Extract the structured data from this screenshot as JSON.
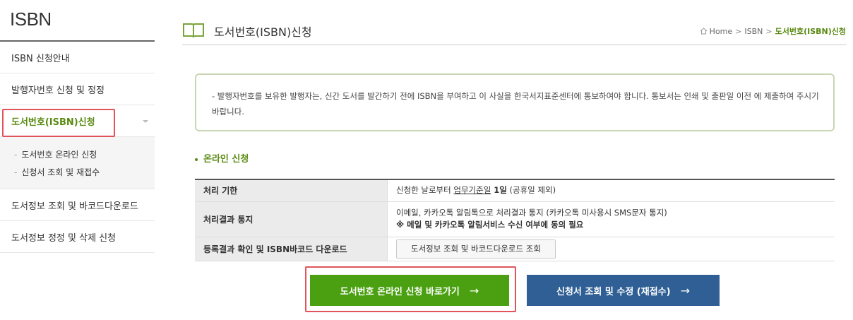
{
  "sidebar": {
    "title": "ISBN",
    "items": [
      {
        "label": "ISBN 신청안내"
      },
      {
        "label": "발행자번호 신청 및 정정"
      },
      {
        "label": "도서번호(ISBN)신청"
      },
      {
        "label": "도서정보 조회 및 바코드다운로드"
      },
      {
        "label": "도서정보 정정 및 삭제 신청"
      }
    ],
    "sub_items": [
      {
        "label": "도서번호 온라인 신청"
      },
      {
        "label": "신청서 조회 및 재접수"
      }
    ],
    "sub_dash": "-"
  },
  "header": {
    "title": "도서번호(ISBN)신청",
    "breadcrumb": [
      "Home",
      "ISBN",
      "도서번호(ISBN)신청"
    ],
    "breadcrumb_sep": ">"
  },
  "notice": {
    "text": "- 발행자번호를 보유한 발행자는, 신간 도서를 발간하기 전에 ISBN을 부여하고 이 사실을 한국서지표준센터에 통보하여야 합니다. 통보서는 인쇄 및 출판일 이전 에 제출하여 주시기 바랍니다."
  },
  "section": {
    "title": "온라인 신청"
  },
  "table": {
    "rows": [
      {
        "label": "처리 기한",
        "value_pre": "신청한 날로부터 ",
        "value_underline": "업무기준일",
        "value_bold": " 1일",
        "value_post": " (공휴일 제외)"
      },
      {
        "label": "처리결과 통지",
        "line1": "이메일, 카카오톡 알림톡으로 처리결과 통지 (카카오톡 미사용시 SMS문자 통지)",
        "line2": "※ 메일 및 카카오톡 알림서비스 수신 여부에 동의 필요"
      },
      {
        "label": "등록결과 확인 및 ISBN바코드 다운로드",
        "button_label": "도서정보 조회 및 바코드다운로드 조회"
      }
    ]
  },
  "buttons": {
    "apply_label": "도서번호 온라인 신청 바로가기",
    "modify_label": "신청서 조회 및 수정 (재접수)",
    "arrow": "→"
  },
  "colors": {
    "accent_green": "#4aa010",
    "accent_blue": "#2f5f94",
    "highlight_red": "#e0545a",
    "title_green": "#5a8a12"
  }
}
